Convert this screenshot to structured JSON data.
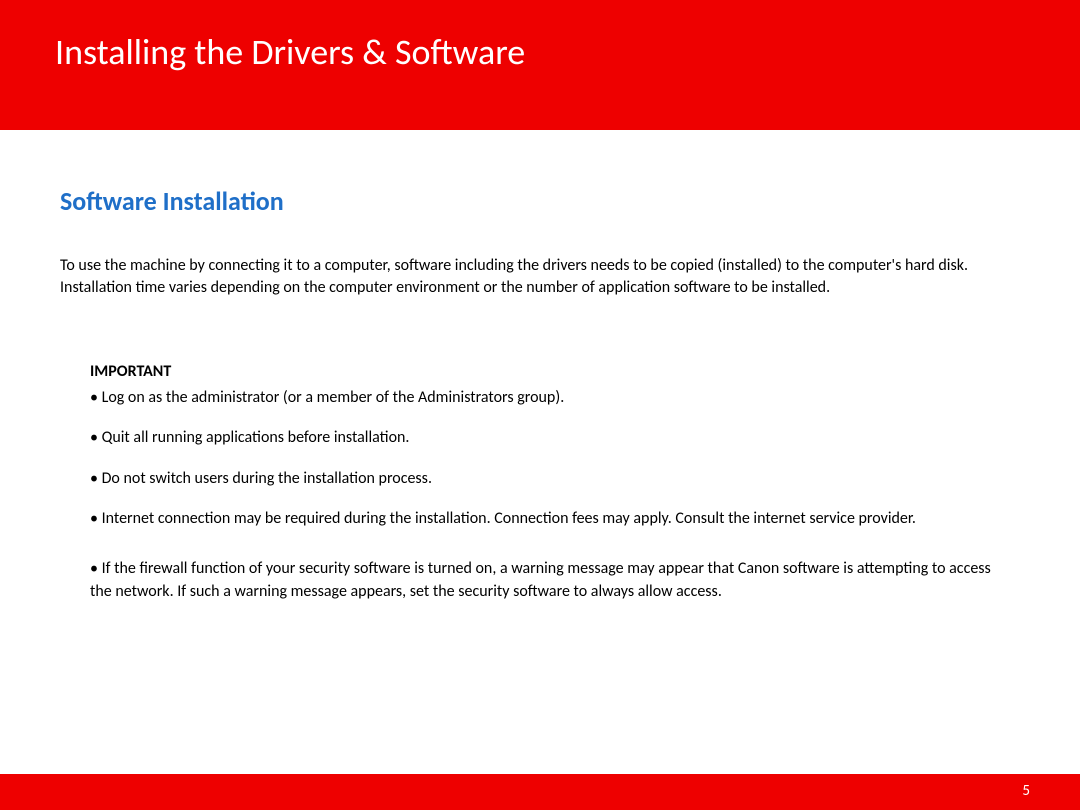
{
  "header": {
    "title": "Installing  the Drivers & Software"
  },
  "section": {
    "heading": "Software Installation",
    "intro": "To use the machine by connecting it to a computer, software including the drivers needs to be copied (installed) to the computer's hard disk. Installation time varies depending on the computer environment or the number of application software to be installed."
  },
  "important": {
    "label": "IMPORTANT",
    "items": [
      "• Log on as the administrator (or a member of the Administrators group).",
      "• Quit all running applications before installation.",
      "• Do not switch users during the installation process.",
      "• Internet connection may be required during the installation. Connection fees may apply. Consult the internet service provider.",
      "• If the firewall function of your security software is turned on, a warning message may appear that Canon software is attempting to access the network. If such a warning message appears, set the security software to always allow access."
    ]
  },
  "footer": {
    "page_number": "5"
  }
}
